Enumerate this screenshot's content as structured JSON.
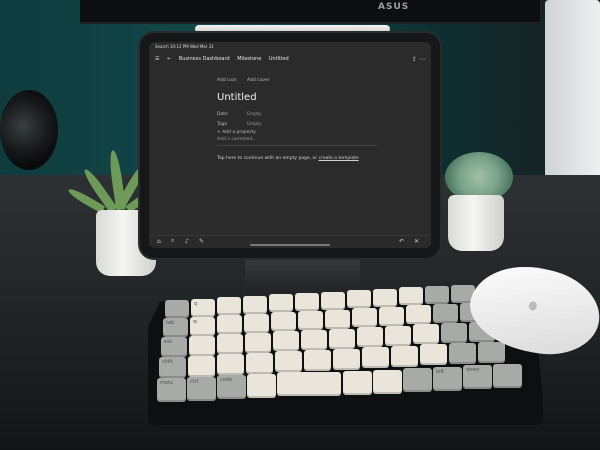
{
  "scene": {
    "description_colors": {
      "wall": "#134a4c",
      "desk": "#2d3133",
      "screen_bg": "#2b2b2c"
    },
    "monitor_brand": "ASUS"
  },
  "tablet": {
    "status_bar": "Search 10:12 PM Wed Mar 31",
    "breadcrumb": [
      "Business Dashboard",
      "Milestone",
      "Untitled"
    ],
    "toolbar_buttons": {
      "add_icon": "Add icon",
      "add_cover": "Add cover"
    },
    "page_title": "Untitled",
    "properties": [
      {
        "name": "Date",
        "value": "Empty"
      },
      {
        "name": "Tags",
        "value": "Empty"
      }
    ],
    "add_property": "+ Add a property",
    "comment_placeholder": "Add a comment...",
    "hint_prefix": "Tap here to continue with an empty page, or",
    "hint_link": "create a template"
  },
  "keyboard": {
    "legends": {
      "r1": "q",
      "r2": "w",
      "tab": "tab",
      "esc": "esc",
      "shift": "shift",
      "meta": "meta",
      "ctrl": "ctrl",
      "code": "code",
      "left": "left",
      "down": "down"
    }
  }
}
